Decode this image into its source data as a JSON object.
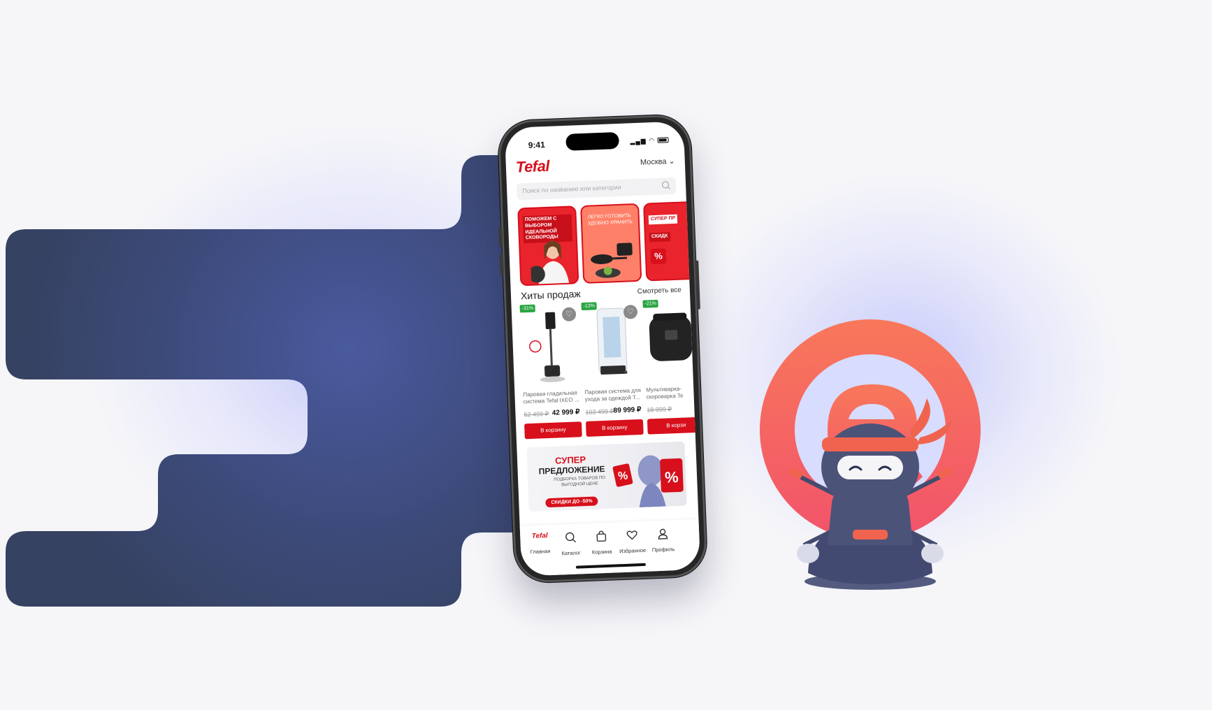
{
  "colors": {
    "brand_shape": "#3b4a78",
    "tefal_red": "#d7101c",
    "logo_ring": "#f75b5c",
    "discount_green": "#2aa542"
  },
  "status_bar": {
    "time": "9:41",
    "signal_icon": "signal-icon",
    "wifi_icon": "wifi-icon",
    "battery_icon": "battery-icon"
  },
  "header": {
    "logo": "Tefal",
    "city": "Москва",
    "city_icon": "chevron-down-icon"
  },
  "search": {
    "placeholder": "Поиск по названию или категории",
    "icon": "search-icon"
  },
  "stories": [
    {
      "text": "ПОМОЖЕМ С ВЫБОРОМ ИДЕАЛЬНОЙ СКОВОРОДЫ"
    },
    {
      "text": "ЛЕГКО ГОТОВИТЬ УДОБНО ХРАНИТЬ"
    },
    {
      "text": "СУПЕР ПР",
      "badge": "СКИДК",
      "icon": "percent-icon"
    }
  ],
  "bestsellers": {
    "title": "Хиты продаж",
    "see_all": "Смотреть все",
    "products": [
      {
        "discount": "-31%",
        "name": "Паровая гладильная система Tefal IXEO ...",
        "old_price": "62 499 ₽",
        "price": "42 999 ₽",
        "button": "В корзину"
      },
      {
        "discount": "-13%",
        "name": "Паровая система для ухода за одеждой T...",
        "old_price": "103 499 ₽",
        "price": "89 999 ₽",
        "button": "В корзину"
      },
      {
        "discount": "-21%",
        "name": "Мультиварка-скороварка Te",
        "old_price": "18 999 ₽",
        "price": "",
        "button": "В корзи"
      }
    ]
  },
  "promo_banner": {
    "title_line1": "СУПЕР",
    "title_line2": "ПРЕДЛОЖЕНИЕ",
    "subtitle": "ПОДБОРКА ТОВАРОВ ПО ВЫГОДНОЙ ЦЕНЕ",
    "badge": "СКИДКИ ДО -50%"
  },
  "tabbar": [
    {
      "label": "Главная",
      "icon": "tefal-logo-icon"
    },
    {
      "label": "Каталог",
      "icon": "search-icon"
    },
    {
      "label": "Корзина",
      "icon": "bag-icon"
    },
    {
      "label": "Избранное",
      "icon": "heart-icon"
    },
    {
      "label": "Профиль",
      "icon": "user-icon"
    }
  ]
}
